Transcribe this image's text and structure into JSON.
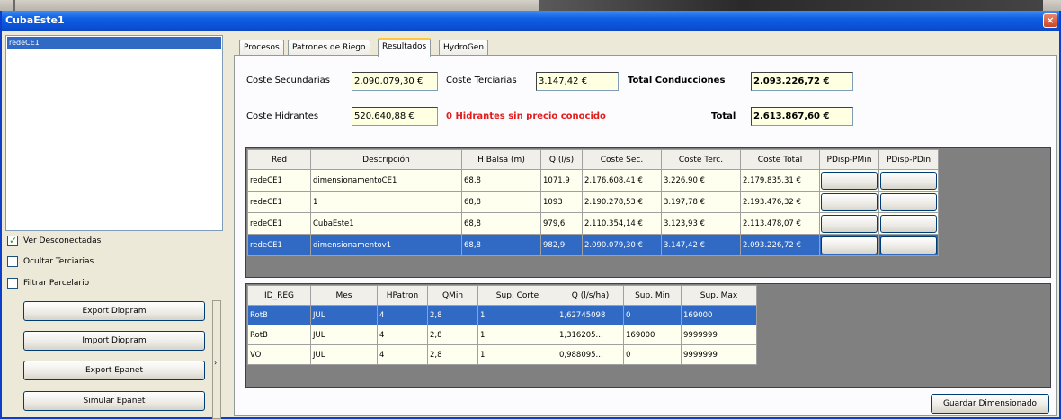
{
  "window": {
    "title": "CubaEste1",
    "close_symbol": "×"
  },
  "left_panel": {
    "list_items": [
      "redeCE1"
    ],
    "checkboxes": [
      {
        "label": "Ver Desconectadas",
        "checked": true
      },
      {
        "label": "Ocultar Terciarias",
        "checked": false
      },
      {
        "label": "Filtrar Parcelario",
        "checked": false
      }
    ],
    "buttons": [
      "Export Diopram",
      "Import Diopram",
      "Export Epanet",
      "Simular Epanet"
    ],
    "splitter_arrow": "›"
  },
  "tabs": [
    {
      "label": "Procesos",
      "active": false
    },
    {
      "label": "Patrones de Riego",
      "active": false
    },
    {
      "label": "Resultados",
      "active": true
    },
    {
      "label": "HydroGen",
      "active": false
    }
  ],
  "costs": {
    "secundarias_label": "Coste Secundarias",
    "secundarias_value": "2.090.079,30 €",
    "terciarias_label": "Coste Terciarias",
    "terciarias_value": "3.147,42 €",
    "total_conducciones_label": "Total Conducciones",
    "total_conducciones_value": "2.093.226,72 €",
    "hidrantes_label": "Coste Hidrantes",
    "hidrantes_value": "520.640,88 €",
    "warning": "0 Hidrantes sin precio conocido",
    "total_label": "Total",
    "total_value": "2.613.867,60 €"
  },
  "results_table": {
    "headers": [
      "Red",
      "Descripción",
      "H Balsa (m)",
      "Q (l/s)",
      "Coste Sec.",
      "Coste Terc.",
      "Coste Total",
      "PDisp-PMin",
      "PDisp-PDin"
    ],
    "rows": [
      {
        "red": "redeCE1",
        "descripcion": "dimensionamentoCE1",
        "h_balsa": "68,8",
        "q": "1071,9",
        "coste_sec": "2.176.608,41 €",
        "coste_terc": "3.226,90 €",
        "coste_total": "2.179.835,31 €"
      },
      {
        "red": "redeCE1",
        "descripcion": "1",
        "h_balsa": "68,8",
        "q": "1093",
        "coste_sec": "2.190.278,53 €",
        "coste_terc": "3.197,78 €",
        "coste_total": "2.193.476,32 €"
      },
      {
        "red": "redeCE1",
        "descripcion": "CubaEste1",
        "h_balsa": "68,8",
        "q": "979,6",
        "coste_sec": "2.110.354,14 €",
        "coste_terc": "3.123,93 €",
        "coste_total": "2.113.478,07 €"
      },
      {
        "red": "redeCE1",
        "descripcion": "dimensionamentov1",
        "h_balsa": "68,8",
        "q": "982,9",
        "coste_sec": "2.090.079,30 €",
        "coste_terc": "3.147,42 €",
        "coste_total": "2.093.226,72 €"
      }
    ],
    "selected_row": 3
  },
  "reg_table": {
    "headers": [
      "ID_REG",
      "Mes",
      "HPatron",
      "QMin",
      "Sup. Corte",
      "Q (l/s/ha)",
      "Sup. Min",
      "Sup. Max"
    ],
    "rows": [
      {
        "id_reg": "RotB",
        "mes": "JUL",
        "hpatron": "4",
        "qmin": "2,8",
        "sup_corte": "1",
        "q": "1,62745098",
        "sup_min": "0",
        "sup_max": "169000"
      },
      {
        "id_reg": "RotB",
        "mes": "JUL",
        "hpatron": "4",
        "qmin": "2,8",
        "sup_corte": "1",
        "q": "1,316205...",
        "sup_min": "169000",
        "sup_max": "9999999"
      },
      {
        "id_reg": "VO",
        "mes": "JUL",
        "hpatron": "4",
        "qmin": "2,8",
        "sup_corte": "1",
        "q": "0,988095...",
        "sup_min": "0",
        "sup_max": "9999999"
      }
    ],
    "selected_row": 0
  },
  "save_button": "Guardar Dimensionado"
}
